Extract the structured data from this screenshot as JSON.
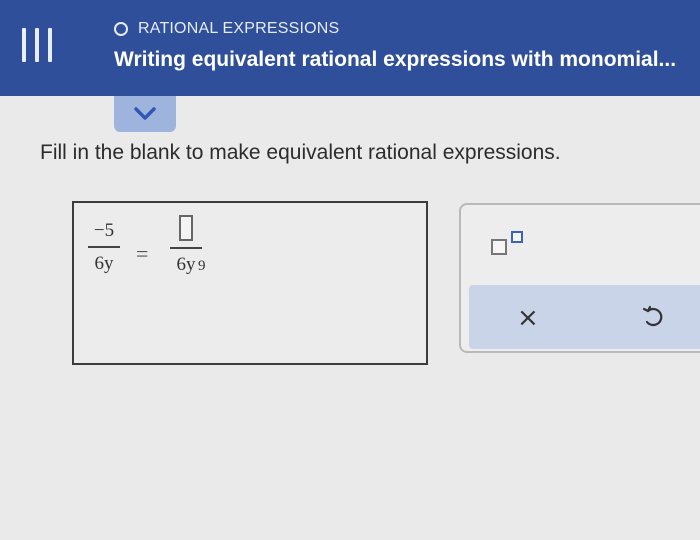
{
  "header": {
    "topic": "RATIONAL EXPRESSIONS",
    "subtitle": "Writing equivalent rational expressions with monomial..."
  },
  "icons": {
    "menu": "hamburger-menu-icon",
    "topic_marker": "circle-outline-icon",
    "expand": "chevron-down-icon",
    "clear": "close-icon",
    "undo": "undo-icon",
    "exponent": "exponent-template-icon"
  },
  "colors": {
    "header_bg": "#2f4f9a",
    "accent": "#3d63b8",
    "tab_bg": "#9fb4dc"
  },
  "problem": {
    "instruction": "Fill in the blank to make equivalent rational expressions.",
    "left_numerator": "−5",
    "left_denominator": "6y",
    "equals": "=",
    "right_denominator": "6y",
    "right_exponent": "9",
    "blank_value": ""
  },
  "keypad": {
    "clear_label": "×"
  }
}
